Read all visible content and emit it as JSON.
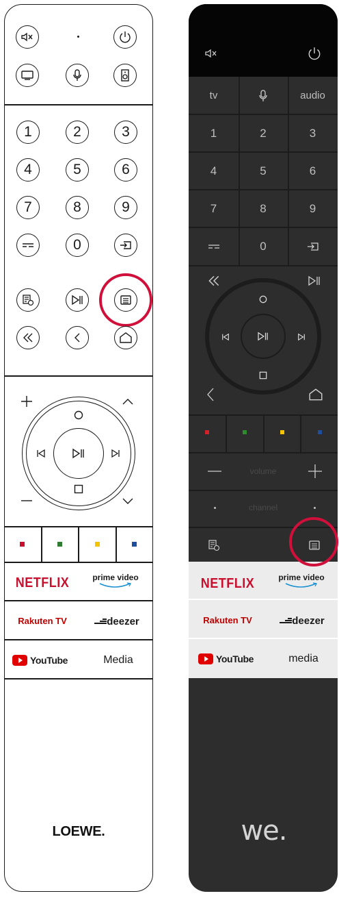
{
  "left_remote": {
    "numbers": [
      "1",
      "2",
      "3",
      "4",
      "5",
      "6",
      "7",
      "8",
      "9",
      "0"
    ],
    "streaming": {
      "netflix": "NETFLIX",
      "prime": "prime video",
      "rakuten": "Rakuten TV",
      "deezer": "deezer",
      "youtube": "YouTube",
      "media": "Media"
    },
    "brand": "LOEWE.",
    "color_keys": [
      "#c8102e",
      "#2e7d32",
      "#f2c500",
      "#1f4e9c"
    ]
  },
  "right_remote": {
    "top_row": [
      "tv",
      "audio"
    ],
    "numbers": [
      "1",
      "2",
      "3",
      "4",
      "5",
      "6",
      "7",
      "8",
      "9",
      "0"
    ],
    "volume_label": "volume",
    "channel_label": "channel",
    "streaming": {
      "netflix": "NETFLIX",
      "prime": "prime video",
      "rakuten": "Rakuten TV",
      "deezer": "deezer",
      "youtube": "YouTube",
      "media": "media"
    },
    "brand": "we.",
    "color_keys": [
      "#d0202a",
      "#2e8b2e",
      "#f2c500",
      "#1f4e9c"
    ]
  },
  "highlight_color": "#d0103a"
}
